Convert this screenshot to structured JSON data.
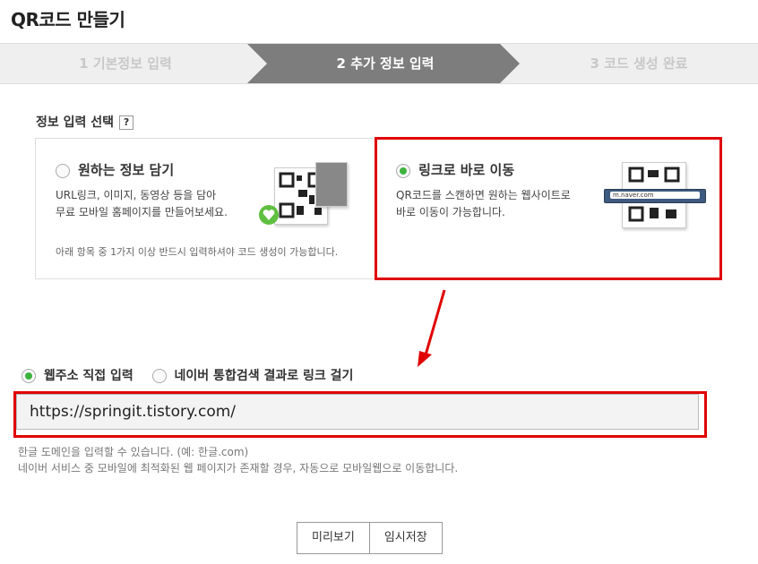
{
  "title": "QR코드 만들기",
  "steps": [
    {
      "label": "1 기본정보 입력"
    },
    {
      "label": "2 추가 정보 입력"
    },
    {
      "label": "3 코드 생성 완료"
    }
  ],
  "section_label": "정보 입력 선택",
  "help_label": "?",
  "option1": {
    "title": "원하는 정보 담기",
    "desc1": "URL링크, 이미지, 동영상 등을 담아",
    "desc2": "무료 모바일 홈페이지를 만들어보세요.",
    "note": "아래 항목 중 1가지 이상 반드시 입력하셔야 코드 생성이 가능합니다."
  },
  "option2": {
    "title": "링크로 바로 이동",
    "desc1": "QR코드를 스캔하면 원하는 웹사이트로",
    "desc2": "바로 이동이 가능합니다.",
    "badge": "m.naver.com"
  },
  "link_radios": {
    "direct": "웹주소 직접 입력",
    "search": "네이버 통합검색 결과로 링크 걸기"
  },
  "url_input": {
    "value": "https://springit.tistory.com/"
  },
  "hints": {
    "line1": "한글 도메인을 입력할 수 있습니다. (예: 한글.com)",
    "line2": "네이버 서비스 중 모바일에 최적화된 웹 페이지가 존재할 경우, 자동으로 모바일웹으로 이동합니다."
  },
  "buttons": {
    "preview": "미리보기",
    "save": "임시저장"
  },
  "colors": {
    "accent_green": "#3db33d",
    "annotation_red": "#e00000",
    "active_step": "#7d7d7d"
  }
}
